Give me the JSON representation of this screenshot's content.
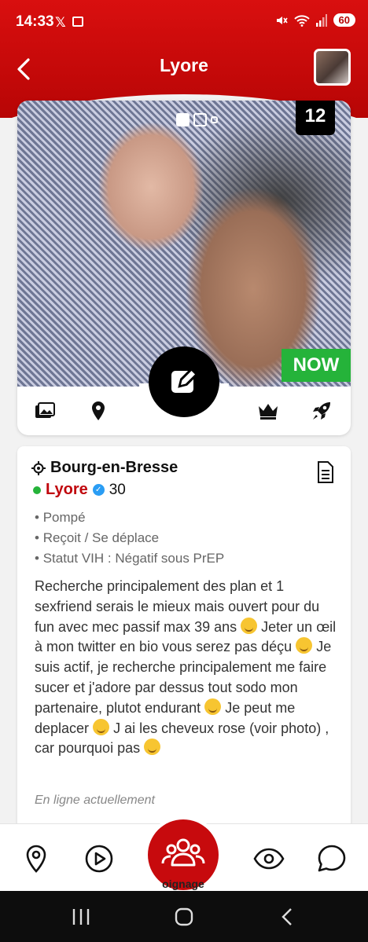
{
  "status_bar": {
    "time": "14:33",
    "battery": "60"
  },
  "header": {
    "title": "Lyore"
  },
  "photos": {
    "count": "12",
    "now_badge": "NOW"
  },
  "profile": {
    "city": "Bourg-en-Bresse",
    "name": "Lyore",
    "age": "30",
    "attributes": [
      "Pompé",
      "Reçoit / Se déplace",
      "Statut VIH : Négatif sous PrEP"
    ],
    "description_parts": [
      "Recherche principalement des plan et 1 sexfriend serais le mieux mais ouvert pour du fun avec mec passif max 39 ans",
      "Jeter un œil à mon twitter en bio vous serez pas déçu",
      "Je suis actif, je recherche principalement me faire sucer et j'adore par dessus tout sodo mon partenaire, plutot endurant",
      "Je peut me deplacer",
      "J ai les cheveux rose (voir photo) , car pourquoi pas"
    ],
    "online_status": "En ligne actuellement"
  },
  "bottom_nav": {
    "center_label": "oignage"
  },
  "colors": {
    "brand_red": "#c70a0d",
    "online_green": "#25b33a",
    "verified_blue": "#2a9df4"
  },
  "icons": [
    "back-icon",
    "gallery-icon",
    "location-pin-icon",
    "crown-icon",
    "rocket-icon",
    "edit-icon",
    "document-icon",
    "map-pin-icon",
    "play-icon",
    "community-icon",
    "eye-icon",
    "chat-icon"
  ]
}
